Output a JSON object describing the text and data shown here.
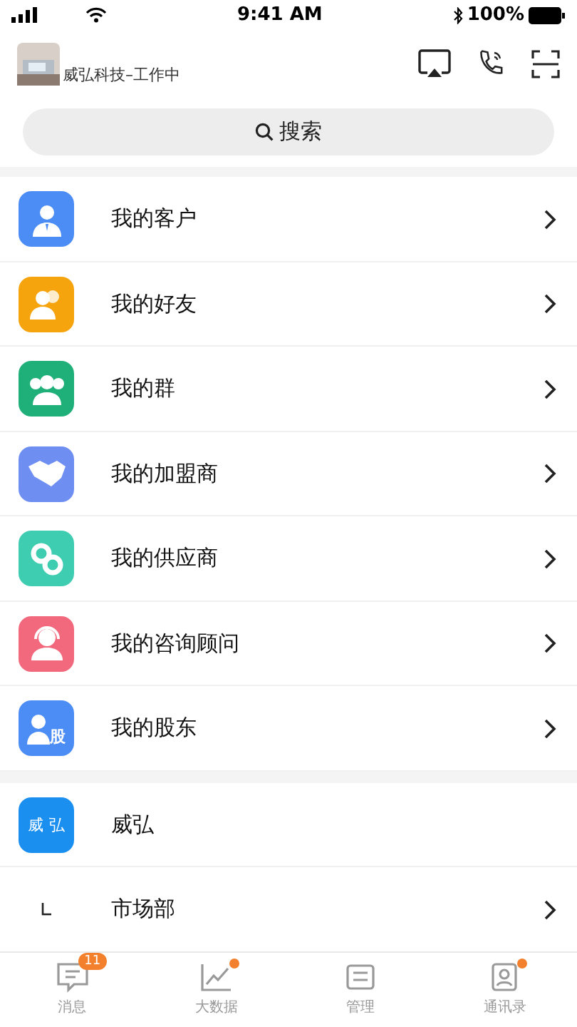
{
  "status_bar": {
    "time": "9:41 AM",
    "battery": "100%"
  },
  "header": {
    "company_status": "威弘科技–工作中"
  },
  "search": {
    "placeholder": "搜索"
  },
  "menu": [
    {
      "kind": "customer",
      "label": "我的客户",
      "color": "#4c8cf5"
    },
    {
      "kind": "friend",
      "label": "我的好友",
      "color": "#f5a40e"
    },
    {
      "kind": "group",
      "label": "我的群",
      "color": "#1fb07a"
    },
    {
      "kind": "partner",
      "label": "我的加盟商",
      "color": "#6e8ef2"
    },
    {
      "kind": "supplier",
      "label": "我的供应商",
      "color": "#3ecdb1"
    },
    {
      "kind": "consultant",
      "label": "我的咨询顾问",
      "color": "#f2687c"
    },
    {
      "kind": "shareholder",
      "label": "我的股东",
      "color": "#4c8cf5",
      "icon_text": "股"
    }
  ],
  "org": {
    "logo_text": [
      "威",
      "弘"
    ],
    "name": "威弘",
    "departments": [
      {
        "name": "市场部"
      }
    ]
  },
  "tabs": [
    {
      "kind": "message",
      "label": "消息",
      "selected": false,
      "badge": "11"
    },
    {
      "kind": "chart",
      "label": "大数据",
      "selected": false,
      "dot": true
    },
    {
      "kind": "manage",
      "label": "管理",
      "selected": false
    },
    {
      "kind": "contacts",
      "label": "通讯录",
      "selected": false,
      "dot": true
    }
  ]
}
